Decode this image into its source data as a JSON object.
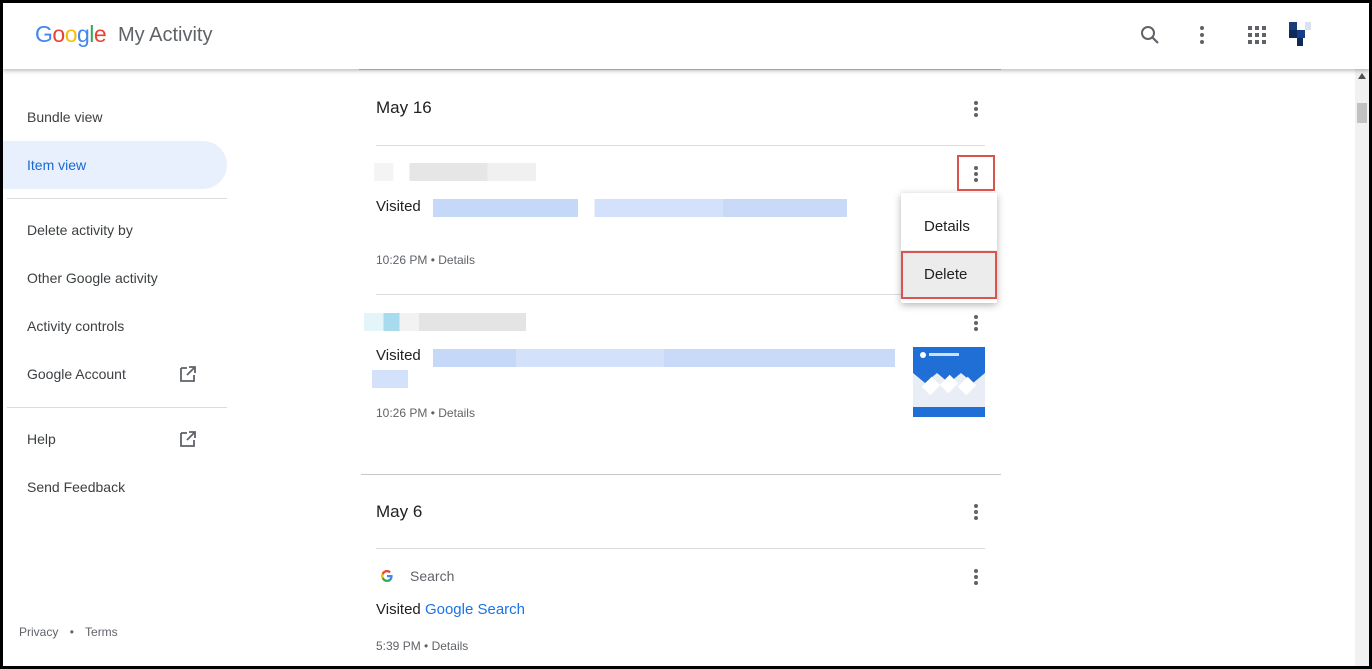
{
  "header": {
    "logo_text": "Google",
    "app_title": "My Activity",
    "icons": [
      "search-icon",
      "more-vert-icon",
      "apps-grid-icon"
    ]
  },
  "sidebar": {
    "items": [
      {
        "label": "Bundle view"
      },
      {
        "label": "Item view"
      },
      {
        "label": "Delete activity by"
      },
      {
        "label": "Other Google activity"
      },
      {
        "label": "Activity controls"
      },
      {
        "label": "Google Account"
      },
      {
        "label": "Help"
      },
      {
        "label": "Send Feedback"
      }
    ],
    "footer": {
      "privacy": "Privacy",
      "separator": "•",
      "terms": "Terms"
    }
  },
  "days": [
    {
      "title": "May 16",
      "items": [
        {
          "visited": "Visited",
          "time": "10:26 PM",
          "separator": "•",
          "details": "Details"
        },
        {
          "visited": "Visited",
          "time": "10:26 PM",
          "separator": "•",
          "details": "Details"
        }
      ]
    },
    {
      "title": "May 6",
      "items": [
        {
          "source": "Search",
          "visited": "Visited",
          "link": "Google Search",
          "time": "5:39 PM",
          "separator": "•",
          "details": "Details"
        }
      ]
    }
  ],
  "menu": {
    "items": [
      {
        "label": "Details"
      },
      {
        "label": "Delete"
      }
    ]
  },
  "colors": {
    "accent": "#1a73e8",
    "highlight_box": "#d9534f",
    "active_bg": "#e8f0fe"
  }
}
